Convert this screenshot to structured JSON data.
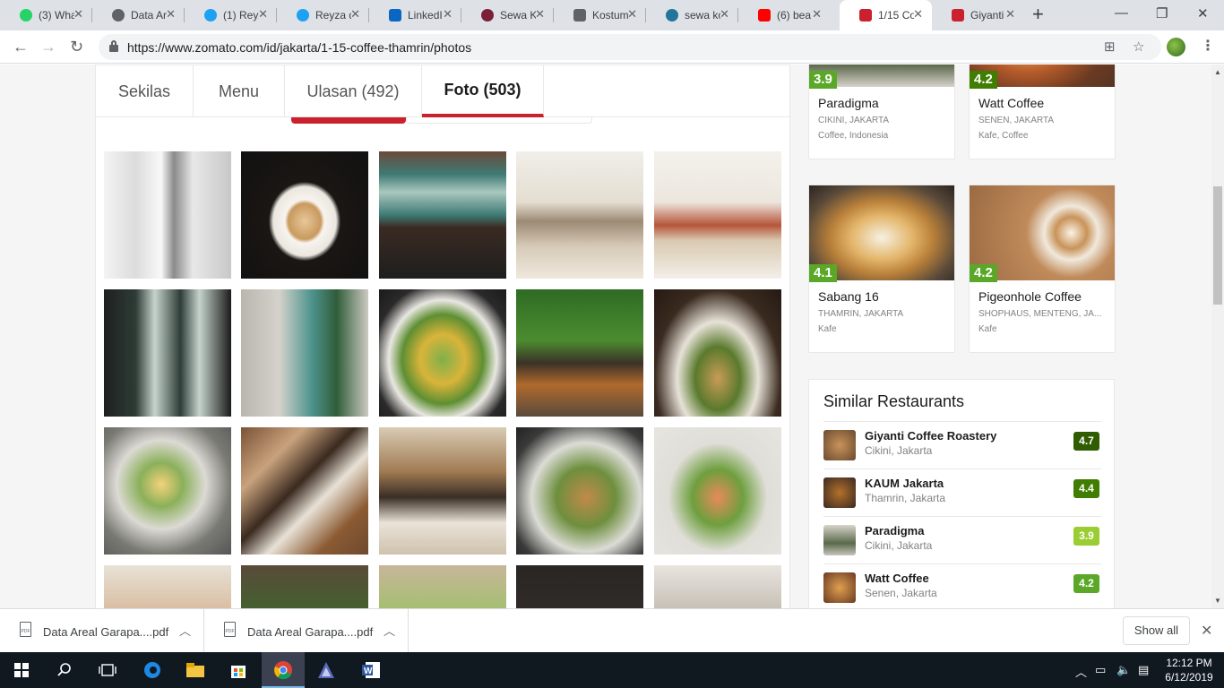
{
  "browser": {
    "tabs": [
      {
        "label": "(3) Wha",
        "color": "#25d366"
      },
      {
        "label": "Data Ar",
        "color": "#5f6368"
      },
      {
        "label": "(1) Reyz",
        "color": "#1da1f2"
      },
      {
        "label": "Reyza d",
        "color": "#1da1f2"
      },
      {
        "label": "LinkedI",
        "color": "#0a66c2"
      },
      {
        "label": "Sewa K",
        "color": "#7b1f3a"
      },
      {
        "label": "Kostum",
        "color": "#5f6368"
      },
      {
        "label": "sewa ko",
        "color": "#21759b"
      },
      {
        "label": "(6) bea",
        "color": "#ff0000"
      },
      {
        "label": "1/15 Co",
        "color": "#cb202d"
      },
      {
        "label": "Giyanti",
        "color": "#cb202d"
      }
    ],
    "url": "https://www.zomato.com/id/jakarta/1-15-coffee-thamrin/photos"
  },
  "page": {
    "tabs": [
      "Sekilas",
      "Menu",
      "Ulasan (492)",
      "Foto (503)"
    ],
    "photo_tiles": [
      "interior-bright",
      "latte-art",
      "green-windows",
      "long-interior",
      "shelves-interior",
      "green-doors",
      "teal-door-garden",
      "corn-salad",
      "plant-brunch",
      "iced-coffee-toast",
      "egg-salad",
      "brunch-table",
      "coffee-bar",
      "chicken-salad",
      "salmon-salad",
      "pasta",
      "plants-table",
      "matcha-drink",
      "dark-interior",
      "cafe-counter"
    ],
    "nearby": [
      {
        "rating": "3.9",
        "rating_color": "#5ba829",
        "name": "Paradigma",
        "location": "CIKINI, JAKARTA",
        "category": "Coffee, Indonesia"
      },
      {
        "rating": "4.2",
        "rating_color": "#3f7e00",
        "name": "Watt Coffee",
        "location": "SENEN, JAKARTA",
        "category": "Kafe, Coffee"
      },
      {
        "rating": "4.1",
        "rating_color": "#5ba829",
        "name": "Sabang 16",
        "location": "THAMRIN, JAKARTA",
        "category": "Kafe"
      },
      {
        "rating": "4.2",
        "rating_color": "#5ba829",
        "name": "Pigeonhole Coffee",
        "location": "SHOPHAUS, MENTENG, JA...",
        "category": "Kafe"
      }
    ],
    "similar": {
      "title": "Similar Restaurants",
      "items": [
        {
          "name": "Giyanti Coffee Roastery",
          "location": "Cikini, Jakarta",
          "rating": "4.7",
          "color": "#305d02"
        },
        {
          "name": "KAUM Jakarta",
          "location": "Thamrin, Jakarta",
          "rating": "4.4",
          "color": "#3f7e00"
        },
        {
          "name": "Paradigma",
          "location": "Cikini, Jakarta",
          "rating": "3.9",
          "color": "#9acd32"
        },
        {
          "name": "Watt Coffee",
          "location": "Senen, Jakarta",
          "rating": "4.2",
          "color": "#5ba829"
        }
      ]
    }
  },
  "downloads": {
    "items": [
      "Data Areal Garapa....pdf",
      "Data Areal Garapa....pdf"
    ],
    "show_all": "Show all"
  },
  "taskbar": {
    "time": "12:12 PM",
    "date": "6/12/2019"
  }
}
